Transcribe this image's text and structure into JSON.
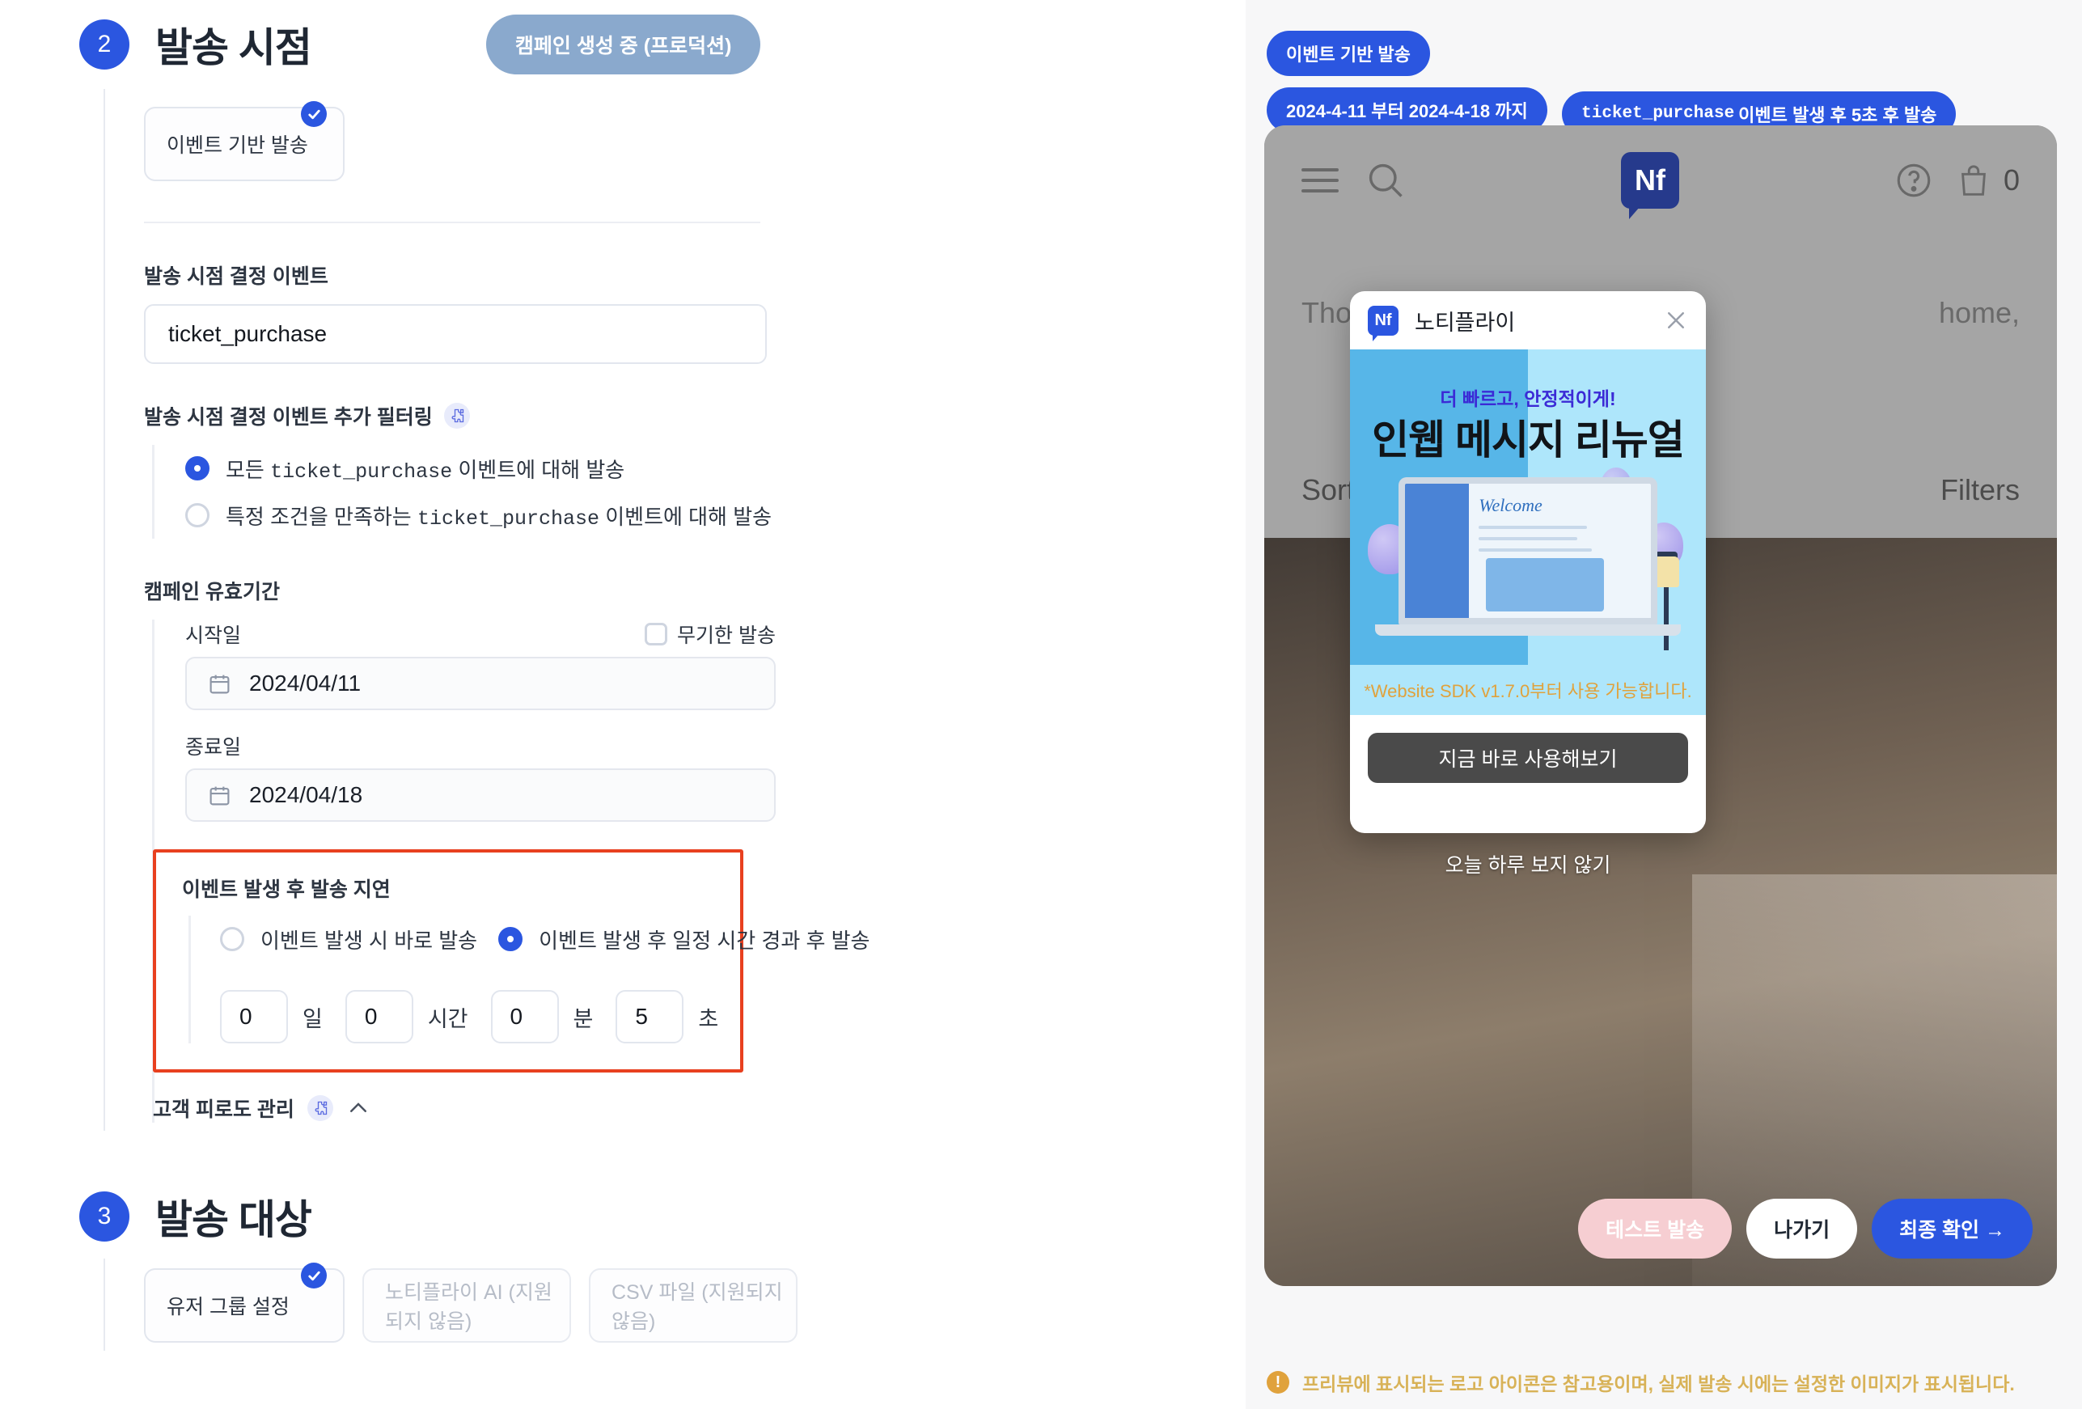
{
  "editor": {
    "section2": {
      "step": "2",
      "title": "발송 시점",
      "status_pill": "캠페인 생성 중 (프로덕션)",
      "send_type_card": "이벤트 기반 발송",
      "trigger_event_label": "발송 시점 결정 이벤트",
      "trigger_event_value": "ticket_purchase",
      "filter_label": "발송 시점 결정 이벤트 추가 필터링",
      "filter_options": [
        {
          "prefix": "모든 ",
          "mono": "ticket_purchase",
          "suffix": " 이벤트에 대해 발송",
          "selected": true
        },
        {
          "prefix": "특정 조건을 만족하는 ",
          "mono": "ticket_purchase",
          "suffix": " 이벤트에 대해 발송",
          "selected": false
        }
      ],
      "validity_label": "캠페인 유효기간",
      "start_label": "시작일",
      "start_value": "2024/04/11",
      "unlimited_label": "무기한 발송",
      "end_label": "종료일",
      "end_value": "2024/04/18",
      "delay_title": "이벤트 발생 후 발송 지연",
      "delay_option_immediate": "이벤트 발생 시 바로 발송",
      "delay_option_after": "이벤트 발생 후 일정 시간 경과 후 발송",
      "delay_days": "0",
      "delay_days_unit": "일",
      "delay_hours": "0",
      "delay_hours_unit": "시간",
      "delay_minutes": "0",
      "delay_minutes_unit": "분",
      "delay_seconds": "5",
      "delay_seconds_unit": "초",
      "fatigue_label": "고객 피로도 관리"
    },
    "section3": {
      "step": "3",
      "title": "발송 대상",
      "cards": [
        {
          "label": "유저 그룹 설정",
          "selected": true
        },
        {
          "label": "노티플라이 AI (지원되지 않음)",
          "selected": false
        },
        {
          "label": "CSV 파일 (지원되지 않음)",
          "selected": false
        }
      ]
    }
  },
  "preview": {
    "tags": [
      "이벤트 기반 발송",
      "2024-4-11 부터 2024-4-18 까지"
    ],
    "tag_event_mono": "ticket_purchase",
    "tag_event_rest": "이벤트 발생 후 5초 후 발송",
    "site": {
      "cart_count": "0",
      "logo_text": "Nf",
      "hero_text_left": "Thoug",
      "hero_text_right": "home,",
      "sort_label": "Sort",
      "filters_label": "Filters"
    },
    "in_app_message": {
      "logo_text": "Nf",
      "title": "노티플라이",
      "banner_sub": "더 빠르고, 안정적이게!",
      "banner_main": "인웹 메시지 리뉴얼",
      "banner_welcome": "Welcome",
      "note": "*Website SDK v1.7.0부터 사용 가능합니다.",
      "cta": "지금 바로 사용해보기",
      "dismiss": "오늘 하루 보지 않기"
    },
    "actions": {
      "test": "테스트 발송",
      "exit": "나가기",
      "confirm": "최종 확인 →"
    },
    "warning": "프리뷰에 표시되는 로고 아이콘은 참고용이며, 실제 발송 시에는 설정한 이미지가 표시됩니다."
  },
  "colors": {
    "accent": "#2b56e0",
    "status_pill": "#8aa9cd",
    "highlight_border": "#e8401f",
    "warning": "#d8b257"
  }
}
